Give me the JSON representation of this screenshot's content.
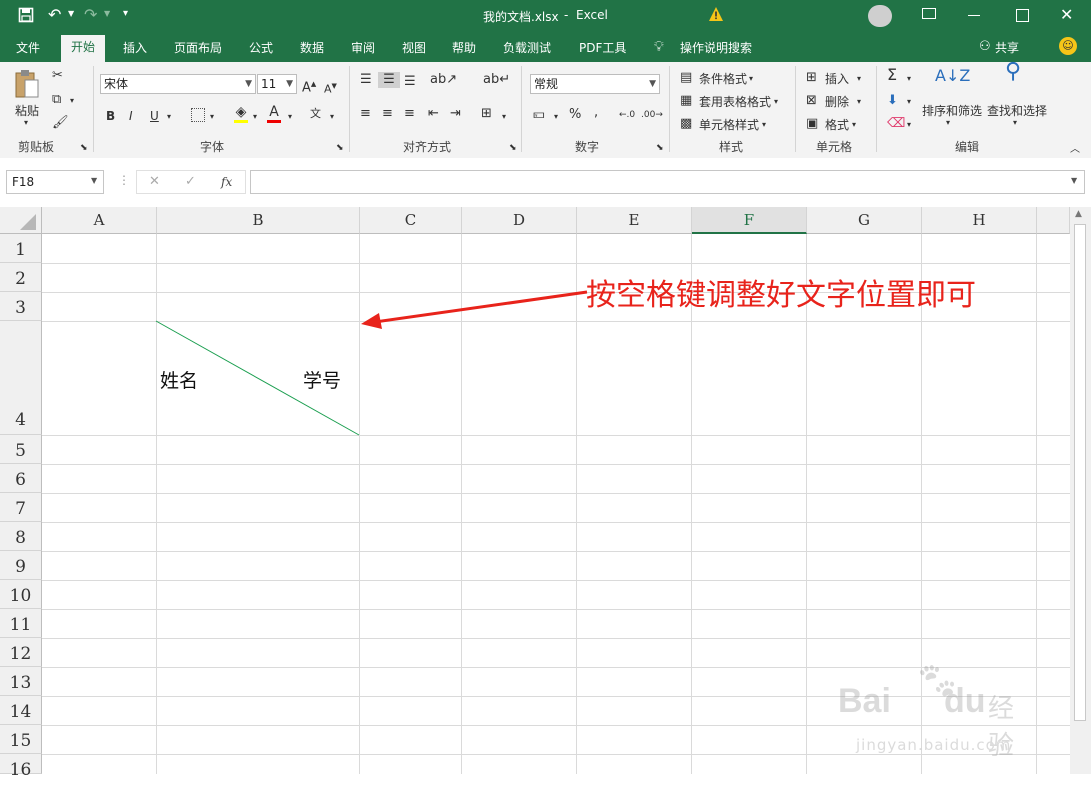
{
  "title_bar": {
    "filename": "我的文档.xlsx",
    "separator": "-",
    "app": "Excel"
  },
  "tabs": [
    "文件",
    "开始",
    "插入",
    "页面布局",
    "公式",
    "数据",
    "审阅",
    "视图",
    "帮助",
    "负载测试",
    "PDF工具",
    "操作说明搜索"
  ],
  "share_label": "共享",
  "ribbon": {
    "clipboard": {
      "paste": "粘贴",
      "label": "剪贴板"
    },
    "font": {
      "name": "宋体",
      "size": "11",
      "label": "字体",
      "bold": "B",
      "italic": "I",
      "underline": "U"
    },
    "alignment": {
      "label": "对齐方式"
    },
    "number": {
      "format": "常规",
      "label": "数字"
    },
    "styles": {
      "conditional": "条件格式",
      "table": "套用表格格式",
      "cell": "单元格样式",
      "label": "样式"
    },
    "cells": {
      "insert": "插入",
      "delete": "删除",
      "format": "格式",
      "label": "单元格"
    },
    "editing": {
      "sort": "排序和筛选",
      "find": "查找和选择",
      "label": "编辑"
    }
  },
  "formula_bar": {
    "name_box": "F18",
    "fx": "fx",
    "value": ""
  },
  "columns": [
    "A",
    "B",
    "C",
    "D",
    "E",
    "F",
    "G",
    "H"
  ],
  "selected_column": "F",
  "rows": [
    "1",
    "2",
    "3",
    "4",
    "5",
    "6",
    "7",
    "8",
    "9",
    "10",
    "11",
    "12",
    "13",
    "14",
    "15",
    "16"
  ],
  "cells": {
    "b4_left": "姓名",
    "b4_right": "学号"
  },
  "annotation": {
    "text": "按空格键调整好文字位置即可",
    "color": "#e8231b"
  },
  "watermark": {
    "brand": "Bai",
    "brand2": "du",
    "suffix": "经验",
    "url": "jingyan.baidu.com"
  },
  "colors": {
    "excel_green": "#217346",
    "diagonal": "#1a9e4f"
  }
}
